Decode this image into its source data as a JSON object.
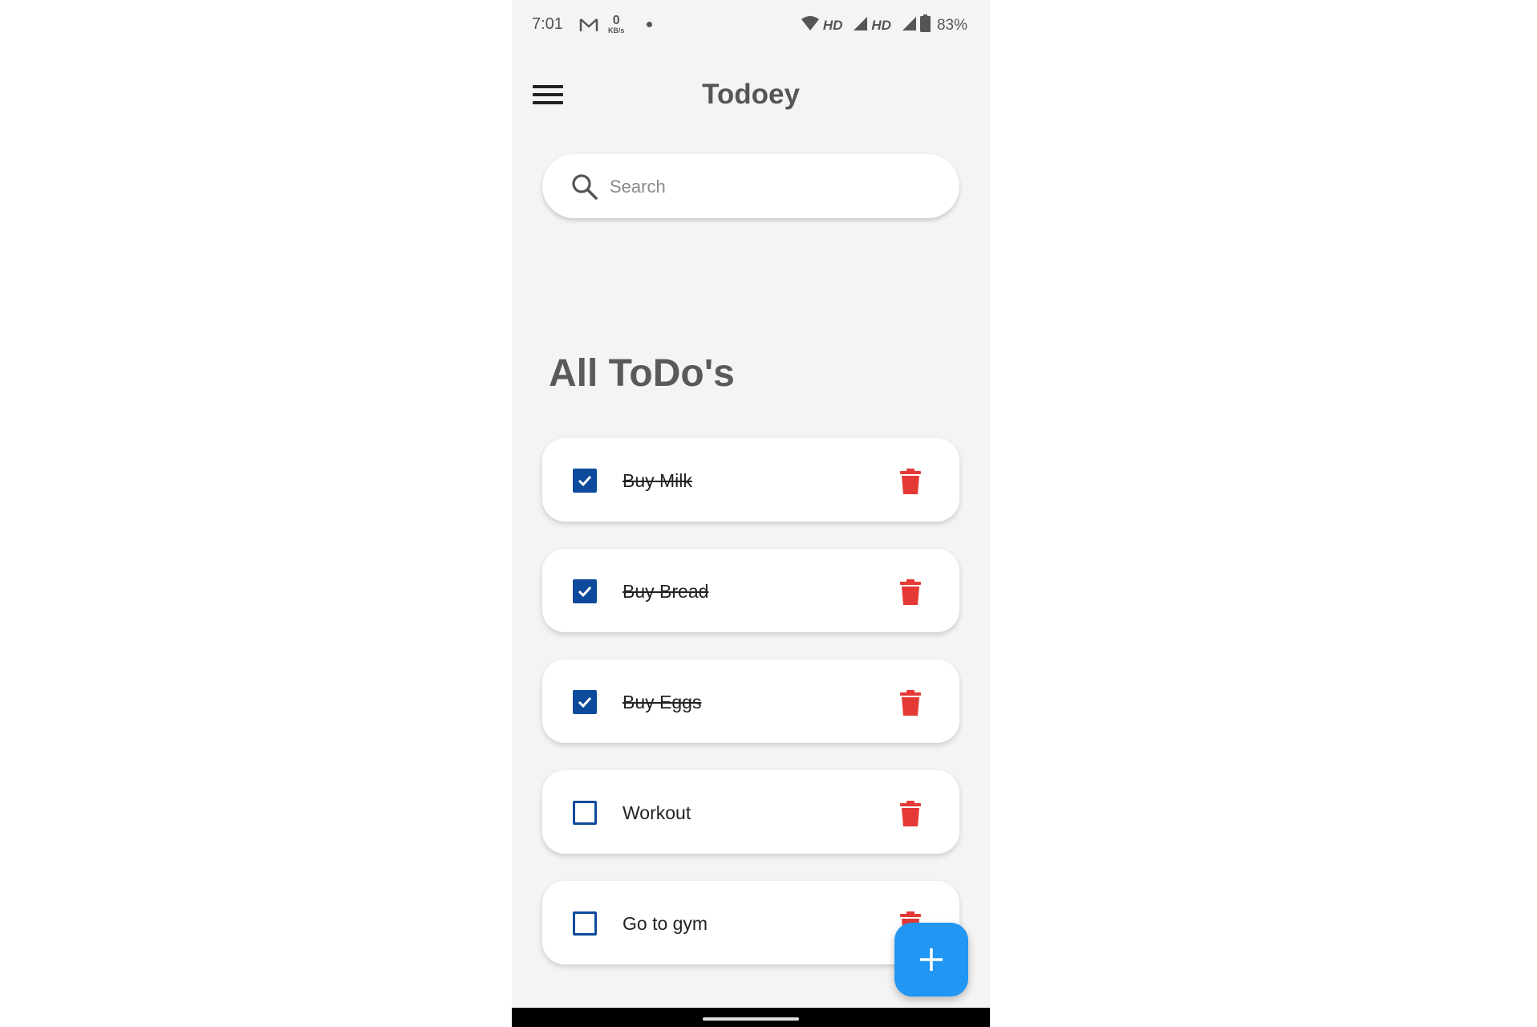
{
  "status_bar": {
    "time": "7:01",
    "net_speed_value": "0",
    "net_speed_unit": "KB/s",
    "hd_label_1": "HD",
    "hd_label_2": "HD",
    "battery": "83%"
  },
  "app_bar": {
    "title": "Todoey"
  },
  "search": {
    "placeholder": "Search"
  },
  "section": {
    "title": "All ToDo's"
  },
  "todos": [
    {
      "text": "Buy Milk",
      "done": true
    },
    {
      "text": "Buy Bread",
      "done": true
    },
    {
      "text": "Buy Eggs",
      "done": true
    },
    {
      "text": "Workout",
      "done": false
    },
    {
      "text": "Go to gym",
      "done": false
    }
  ],
  "colors": {
    "checkbox": "#0e4a9c",
    "delete": "#e53935",
    "fab": "#2196f3",
    "background": "#f4f4f4"
  },
  "icons": {
    "menu": "menu-icon",
    "search": "search-icon",
    "delete": "trash-icon",
    "add": "plus-icon"
  }
}
